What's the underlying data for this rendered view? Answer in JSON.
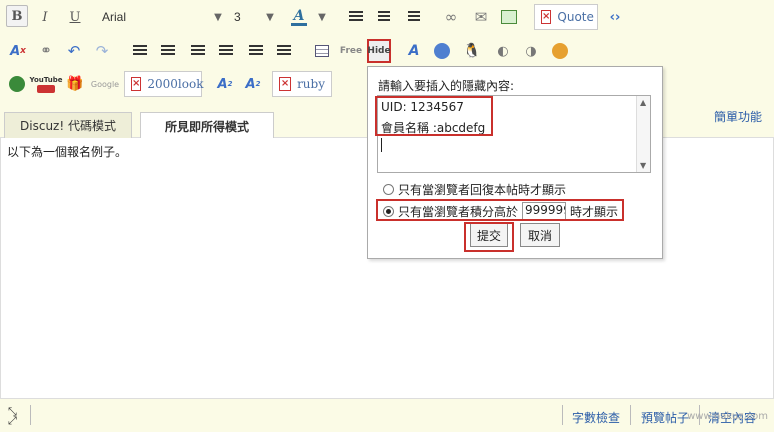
{
  "toolbar": {
    "font_name": "Arial",
    "font_size": "3",
    "quote_label": "Quote",
    "row3_item1_label": "2000look",
    "row3_item2_label": "ruby",
    "bold_label": "B",
    "italic_label": "I",
    "underline_label": "U",
    "font_color_label": "A",
    "free_label": "Free",
    "hide_label": "Hide",
    "youtube_label": "YouTube",
    "google_label": "Google"
  },
  "tabs": {
    "discuz_code_mode": "Discuz! 代碼模式",
    "wysiwyg_mode": "所見即所得模式"
  },
  "simple_mode_link": "簡單功能",
  "editor": {
    "content": "以下為一個報名例子。"
  },
  "hide_popup": {
    "prompt": "請輸入要插入的隱藏內容:",
    "content_line1": "UID: 1234567",
    "content_line2": "會員名稱 :abcdefg",
    "option_reply": "只有當瀏覽者回復本帖時才顯示",
    "option_credit_prefix": "只有當瀏覽者積分高於",
    "credit_value": "999999",
    "option_credit_suffix": "時才顯示",
    "selected_option": "credit",
    "submit_label": "提交",
    "cancel_label": "取消"
  },
  "statusbar": {
    "word_check": "字數檢查",
    "preview": "預覽帖子",
    "clear": "清空內容"
  },
  "watermark": "www.nakuz.com",
  "colors": {
    "toolbar_bg": "#fbfbe6",
    "highlight_red": "#c9302c",
    "link_blue": "#2a5ca8"
  }
}
